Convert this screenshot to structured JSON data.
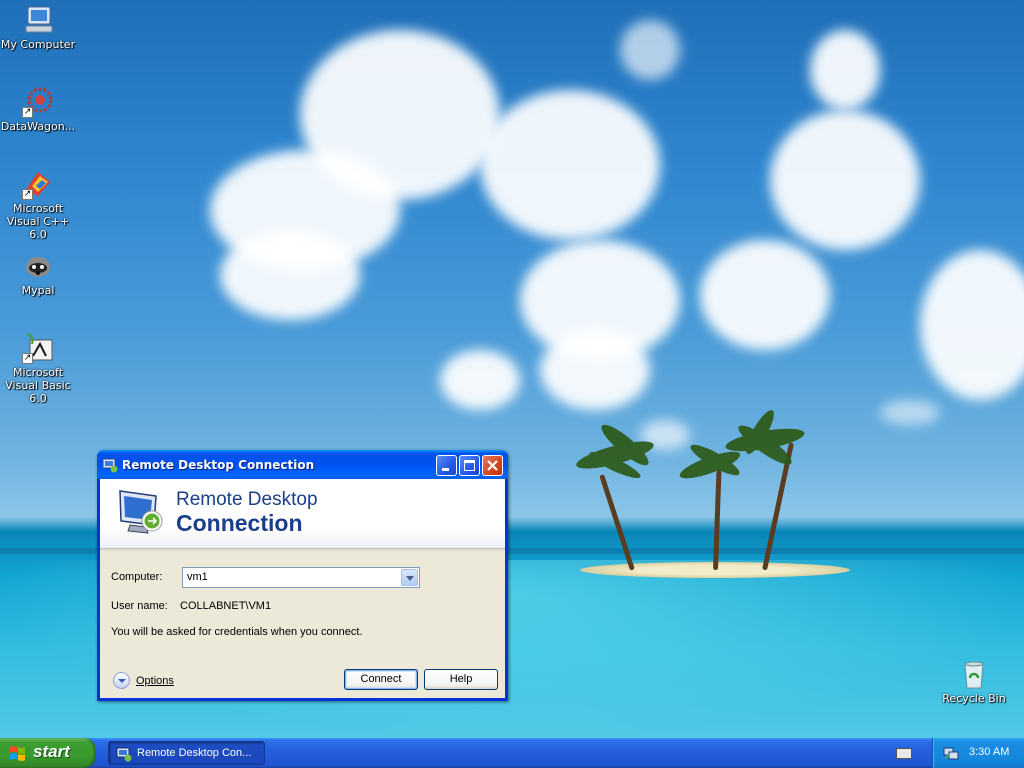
{
  "desktop": {
    "icons": [
      {
        "label": "My Computer",
        "icon": "my-computer-icon"
      },
      {
        "label": "DataWagon...",
        "icon": "datawagon-icon"
      },
      {
        "label": "Microsoft Visual C++ 6.0",
        "icon": "visual-cpp-icon"
      },
      {
        "label": "Mypal",
        "icon": "mypal-icon"
      },
      {
        "label": "Microsoft Visual Basic 6.0",
        "icon": "visual-basic-icon"
      },
      {
        "label": "Recycle Bin",
        "icon": "recycle-bin-icon"
      }
    ]
  },
  "window": {
    "title": "Remote Desktop Connection",
    "banner_line1": "Remote Desktop",
    "banner_line2": "Connection",
    "computer_label": "Computer:",
    "computer_value": "vm1",
    "username_label": "User name:",
    "username_value": "COLLABNET\\VM1",
    "info_text": "You will be asked for credentials when you connect.",
    "options_label": "Options",
    "connect_label": "Connect",
    "help_label": "Help"
  },
  "taskbar": {
    "start_label": "start",
    "task_label": "Remote Desktop Con...",
    "clock": "3:30 AM"
  },
  "colors": {
    "titlebar": "#0053ee",
    "window_frame": "#0831d9",
    "dialog_bg": "#ece9d8",
    "start_green": "#399a2f",
    "taskbar_blue": "#245edb"
  }
}
